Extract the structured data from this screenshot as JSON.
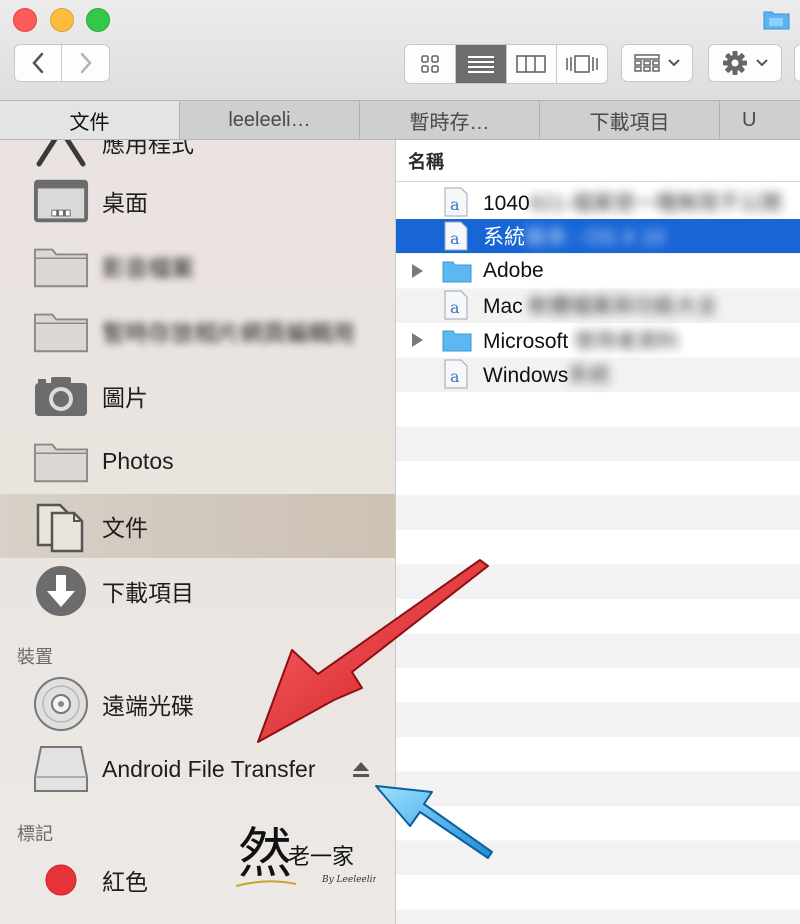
{
  "toolbar": {
    "view_modes": [
      "icon-view",
      "list-view",
      "column-view",
      "cover-flow-view"
    ],
    "active_view": "list-view"
  },
  "tabs": [
    {
      "label": "文件",
      "active": true
    },
    {
      "label": "leeleeli…",
      "active": false
    },
    {
      "label": "暫時存…",
      "active": false
    },
    {
      "label": "下載項目",
      "active": false
    },
    {
      "label": "U",
      "active": false
    }
  ],
  "sidebar": {
    "partial_top_label": "應用程式",
    "favorites": [
      {
        "label": "桌面",
        "icon": "desktop-icon"
      },
      {
        "label": "影音檔案",
        "icon": "folder-icon",
        "blurred": true
      },
      {
        "label": "暫時存放相片網頁編輯用",
        "icon": "folder-icon",
        "blurred": true
      },
      {
        "label": "圖片",
        "icon": "camera-icon"
      },
      {
        "label": "Photos",
        "icon": "folder-icon"
      },
      {
        "label": "文件",
        "icon": "documents-icon",
        "selected": true
      },
      {
        "label": "下載項目",
        "icon": "download-icon"
      }
    ],
    "devices_header": "裝置",
    "devices": [
      {
        "label": "遠端光碟",
        "icon": "disc-icon"
      },
      {
        "label": "Android File Transfer",
        "icon": "drive-icon",
        "eject": true
      }
    ],
    "tags_header": "標記",
    "tags": [
      {
        "label": "紅色",
        "color": "#e8323a"
      }
    ]
  },
  "filelist": {
    "column_name": "名稱",
    "rows": [
      {
        "visible": "1040",
        "hidden": "821-檔案使一種無限不公開",
        "type": "text-doc",
        "selected": false
      },
      {
        "visible": "系統",
        "hidden": "版本 - OS X 10",
        "type": "text-doc",
        "selected": true
      },
      {
        "visible": "Adobe",
        "hidden": "",
        "type": "folder",
        "expandable": true,
        "selected": false
      },
      {
        "visible": "Mac",
        "hidden": " 軟體檔案與功能大全",
        "type": "text-doc",
        "selected": false
      },
      {
        "visible": "Microsoft",
        "hidden": " 使用者資料",
        "type": "folder",
        "expandable": true,
        "selected": false
      },
      {
        "visible": "Windows",
        "hidden": "系統",
        "type": "text-doc",
        "selected": false
      }
    ]
  },
  "watermark": {
    "text": "然 老一家",
    "sub": "By Leeleelin"
  },
  "annotations": {
    "red_arrow": "pointing to Android File Transfer",
    "blue_arrow": "pointing to eject button"
  }
}
